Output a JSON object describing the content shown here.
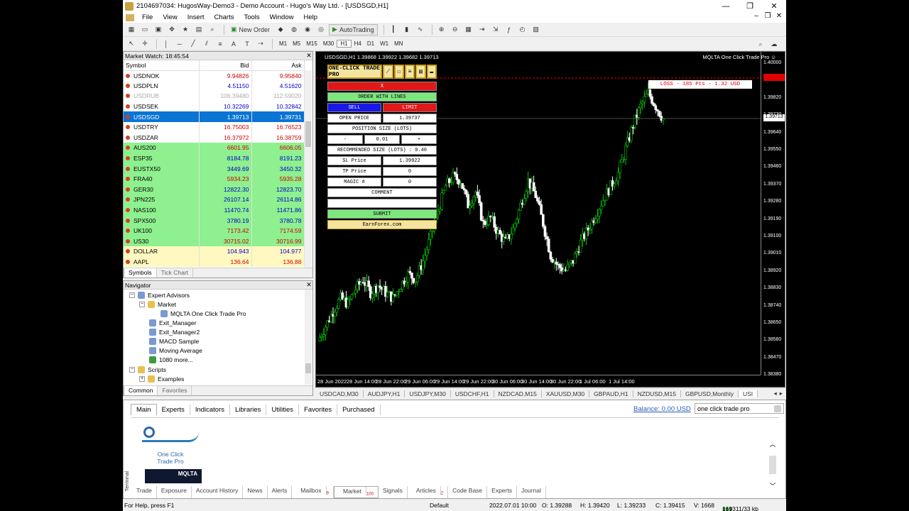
{
  "window": {
    "title": "2104697034: HugosWay-Demo3 - Demo Account - Hugo's Way Ltd. - [USDSGD,H1]",
    "min": "—",
    "max": "❐",
    "close": "✕"
  },
  "menu": [
    "File",
    "View",
    "Insert",
    "Charts",
    "Tools",
    "Window",
    "Help"
  ],
  "menu_right": [
    "–",
    "❐",
    "✕"
  ],
  "toolbar": {
    "new_order": "New Order",
    "autotrading": "AutoTrading",
    "timeframes": [
      "M1",
      "M5",
      "M15",
      "M30",
      "H1",
      "H4",
      "D1",
      "W1",
      "MN"
    ],
    "active_timeframe": "H1"
  },
  "market_watch": {
    "title": "Market Watch: 18:45:54",
    "columns": [
      "Symbol",
      "Bid",
      "Ask"
    ],
    "rows": [
      {
        "symbol": "USDNOK",
        "bid": "9.94826",
        "ask": "9.95840",
        "style": "white",
        "bid_color": "red",
        "ask_color": "red"
      },
      {
        "symbol": "USDPLN",
        "bid": "4.51150",
        "ask": "4.51620",
        "style": "white",
        "bid_color": "blue",
        "ask_color": "blue"
      },
      {
        "symbol": "USDRUB",
        "bid": "106.39480",
        "ask": "112.59020",
        "style": "gray",
        "bid_color": "blue",
        "ask_color": "blue"
      },
      {
        "symbol": "USDSEK",
        "bid": "10.32269",
        "ask": "10.32842",
        "style": "white",
        "bid_color": "blue",
        "ask_color": "blue"
      },
      {
        "symbol": "USDSGD",
        "bid": "1.39713",
        "ask": "1.39731",
        "style": "selected",
        "bid_color": "",
        "ask_color": ""
      },
      {
        "symbol": "USDTRY",
        "bid": "16.75003",
        "ask": "16.76523",
        "style": "white",
        "bid_color": "red",
        "ask_color": "red"
      },
      {
        "symbol": "USDZAR",
        "bid": "16.37972",
        "ask": "16.38759",
        "style": "white",
        "bid_color": "red",
        "ask_color": "red"
      },
      {
        "symbol": "AUS200",
        "bid": "6601.95",
        "ask": "6606.05",
        "style": "green",
        "bid_color": "red",
        "ask_color": "red"
      },
      {
        "symbol": "ESP35",
        "bid": "8184.78",
        "ask": "8191.23",
        "style": "green",
        "bid_color": "blue",
        "ask_color": "blue"
      },
      {
        "symbol": "EUSTX50",
        "bid": "3449.69",
        "ask": "3450.32",
        "style": "green",
        "bid_color": "blue",
        "ask_color": "blue"
      },
      {
        "symbol": "FRA40",
        "bid": "5934.23",
        "ask": "5935.28",
        "style": "green",
        "bid_color": "red",
        "ask_color": "red"
      },
      {
        "symbol": "GER30",
        "bid": "12822.30",
        "ask": "12823.70",
        "style": "green",
        "bid_color": "blue",
        "ask_color": "blue"
      },
      {
        "symbol": "JPN225",
        "bid": "26107.14",
        "ask": "26114.86",
        "style": "green",
        "bid_color": "blue",
        "ask_color": "blue"
      },
      {
        "symbol": "NAS100",
        "bid": "11470.74",
        "ask": "11471.86",
        "style": "green",
        "bid_color": "blue",
        "ask_color": "blue"
      },
      {
        "symbol": "SPX500",
        "bid": "3780.19",
        "ask": "3780.78",
        "style": "green",
        "bid_color": "blue",
        "ask_color": "blue"
      },
      {
        "symbol": "UK100",
        "bid": "7173.42",
        "ask": "7174.59",
        "style": "green",
        "bid_color": "red",
        "ask_color": "red"
      },
      {
        "symbol": "US30",
        "bid": "30715.02",
        "ask": "30716.99",
        "style": "green",
        "bid_color": "red",
        "ask_color": "red"
      },
      {
        "symbol": "DOLLAR",
        "bid": "104.943",
        "ask": "104.977",
        "style": "yellow",
        "bid_color": "blue",
        "ask_color": "blue"
      },
      {
        "symbol": "AAPL",
        "bid": "136.64",
        "ask": "136.88",
        "style": "yellow",
        "bid_color": "red",
        "ask_color": "red"
      }
    ],
    "tabs": [
      "Symbols",
      "Tick Chart"
    ]
  },
  "navigator": {
    "title": "Navigator",
    "items": {
      "expert_advisors": "Expert Advisors",
      "market": "Market",
      "mqlta": "MQLTA One Click Trade Pro",
      "exit_manager": "Exit_Manager",
      "exit_manager2": "Exit_Manager2",
      "macd": "MACD Sample",
      "moving_average": "Moving Average",
      "more": "1080 more...",
      "scripts": "Scripts",
      "examples": "Examples"
    },
    "tabs": [
      "Common",
      "Favorites"
    ]
  },
  "chart": {
    "header": "USDSGD,H1  1.39868 1.39922 1.39682 1.39713",
    "ea_label": "MQLTA One Click Trade Pro ☺",
    "current_price": "1.39713",
    "loss_label": "LOSS - 185 Pts - 1.32 USD",
    "loss_price": "1.39922",
    "y_ticks": [
      "1.40000",
      "1.39910",
      "1.39820",
      "1.39730",
      "1.39640",
      "1.39550",
      "1.39460",
      "1.39370",
      "1.39280",
      "1.39190",
      "1.39100",
      "1.39010",
      "1.38920",
      "1.38830",
      "1.38740",
      "1.38650",
      "1.38560",
      "1.38470",
      "1.38380"
    ],
    "x_ticks": [
      "28 Jun 2022",
      "28 Jun 14:00",
      "28 Jun 22:00",
      "29 Jun 06:00",
      "29 Jun 14:00",
      "29 Jun 22:00",
      "30 Jun 06:00",
      "30 Jun 14:00",
      "30 Jun 22:00",
      "1 Jul 06:00",
      "1 Jul 14:00"
    ],
    "colors": {
      "up": "#00c000",
      "down": "#ffffff",
      "bg": "#000000"
    }
  },
  "chart_data": {
    "type": "candlestick",
    "title": "USDSGD,H1",
    "ylim": [
      1.3834,
      1.4004
    ],
    "x": [
      "28 Jun 2022",
      "28 Jun 14:00",
      "28 Jun 22:00",
      "29 Jun 06:00",
      "29 Jun 14:00",
      "29 Jun 22:00",
      "30 Jun 06:00",
      "30 Jun 14:00",
      "30 Jun 22:00",
      "1 Jul 06:00",
      "1 Jul 14:00"
    ],
    "close_path": [
      1.3852,
      1.386,
      1.3868,
      1.3875,
      1.3872,
      1.388,
      1.3885,
      1.3878,
      1.3882,
      1.3878,
      1.3875,
      1.3882,
      1.3888,
      1.3885,
      1.3895,
      1.3908,
      1.3922,
      1.3935,
      1.394,
      1.3938,
      1.3925,
      1.3932,
      1.3915,
      1.3918,
      1.391,
      1.3905,
      1.3912,
      1.3925,
      1.3938,
      1.393,
      1.3915,
      1.3898,
      1.3892,
      1.389,
      1.3895,
      1.3905,
      1.3912,
      1.392,
      1.3928,
      1.3935,
      1.3942,
      1.3955,
      1.3968,
      1.3978,
      1.3985,
      1.3978,
      1.3971
    ]
  },
  "one_click": {
    "brand": "ONE-CLICK TRADE PRO",
    "icons": [
      "⟋",
      "☐",
      "≡",
      "▤",
      "▬"
    ],
    "close_x": "X",
    "order_with_lines": "ORDER WITH LINES",
    "sell": "SELL",
    "limit": "LIMIT",
    "open_price_label": "OPEN PRICE",
    "open_price": "1.39737",
    "position_size": "POSITION SIZE (LOTS)",
    "minus": "-",
    "lots": "0.01",
    "plus": "+",
    "recommended": "RECOMMENDED SIZE (LOTS) : 0.40",
    "sl_label": "SL Price",
    "sl_value": "1.39922",
    "tp_label": "TP Price",
    "tp_value": "0",
    "magic_label": "MAGIC #",
    "magic_value": "0",
    "comment": "COMMENT",
    "comment_value": "",
    "submit": "SUBMIT",
    "site": "EarnForex.com"
  },
  "symbol_tabs": [
    "USDCAD,M30",
    "AUDJPY,H1",
    "USDJPY,M30",
    "USDCHF,H1",
    "NZDCAD,M15",
    "XAUUSD,M30",
    "GBPAUD,H1",
    "NZDUSD,M15",
    "GBPUSD,Monthly",
    "USI"
  ],
  "terminal": {
    "tabs": [
      "Main",
      "Experts",
      "Indicators",
      "Libraries",
      "Utilities",
      "Favorites",
      "Purchased"
    ],
    "balance": "Balance: 0.00 USD",
    "search": "one click trade pro",
    "product_name": "One Click Trade Pro",
    "product_brand": "MQLTA",
    "side_label": "Terminal",
    "bottom_tabs": [
      "Trade",
      "Exposure",
      "Account History",
      "News",
      "Alerts",
      "Mailbox",
      "Market",
      "Signals",
      "Articles",
      "Code Base",
      "Experts",
      "Journal"
    ],
    "mailbox_count": "9",
    "market_count": "100",
    "articles_count": "2"
  },
  "statusbar": {
    "help": "For Help, press F1",
    "profile": "Default",
    "datetime": "2022.07.01 10:00",
    "open": "O: 1.39288",
    "high": "H: 1.39420",
    "low": "L: 1.39233",
    "close": "C: 1.39415",
    "volume": "V: 1668",
    "traffic": "169311/33 kb"
  }
}
